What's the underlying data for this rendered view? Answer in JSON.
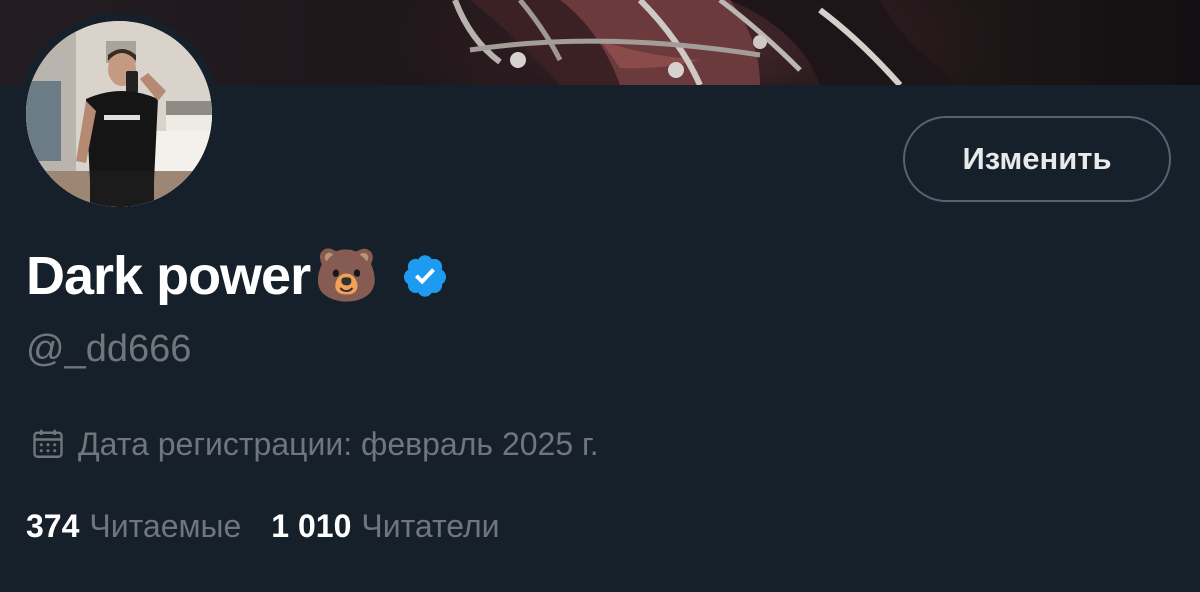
{
  "profile": {
    "display_name": "Dark power",
    "name_emoji": "🐻",
    "handle": "@_dd666",
    "edit_button_label": "Изменить",
    "joined_text": "Дата регистрации: февраль 2025 г.",
    "following_count": "374",
    "following_label": "Читаемые",
    "followers_count": "1 010",
    "followers_label": "Читатели"
  },
  "icons": {
    "verified": "verified-badge-icon",
    "calendar": "calendar-icon"
  },
  "colors": {
    "background": "#15202b",
    "verified_blue": "#1d9bf0",
    "secondary_text": "#71767b",
    "button_border": "#536471"
  }
}
